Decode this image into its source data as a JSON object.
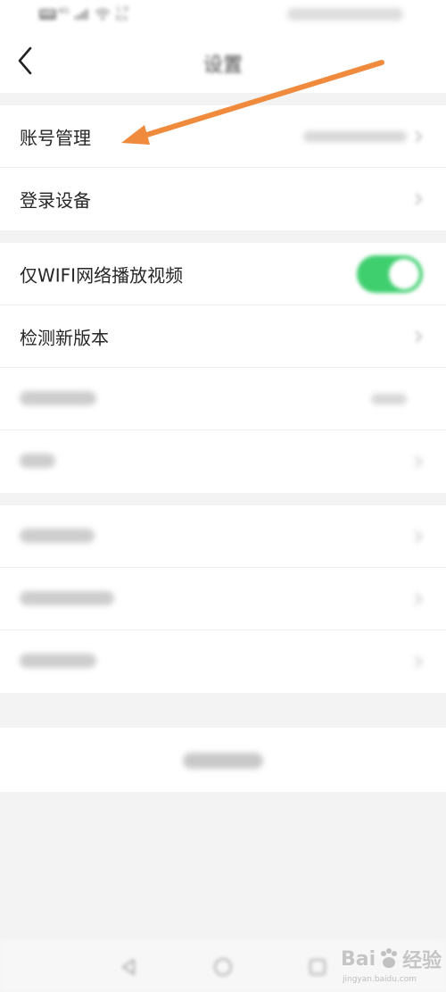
{
  "status_bar": {
    "network_hd": "HD",
    "network_gen": "4G",
    "speed_value": "1.9",
    "speed_unit": "K/s"
  },
  "header": {
    "title": "设置",
    "back_icon": "chevron-left-icon"
  },
  "settings": {
    "account_management": {
      "label": "账号管理"
    },
    "login_devices": {
      "label": "登录设备"
    },
    "wifi_only_video": {
      "label": "仅WIFI网络播放视频",
      "toggle_on": true,
      "toggle_color": "#3fcf6f"
    },
    "check_update": {
      "label": "检测新版本"
    }
  },
  "annotation": {
    "arrow_color": "#f08a3c"
  },
  "navbar": {
    "icons": [
      "back-triangle-icon",
      "home-circle-icon",
      "recents-square-icon"
    ]
  },
  "watermark": {
    "brand": "Bai",
    "brand_suffix": "经验",
    "sub": "jingyan.baidu.com"
  }
}
